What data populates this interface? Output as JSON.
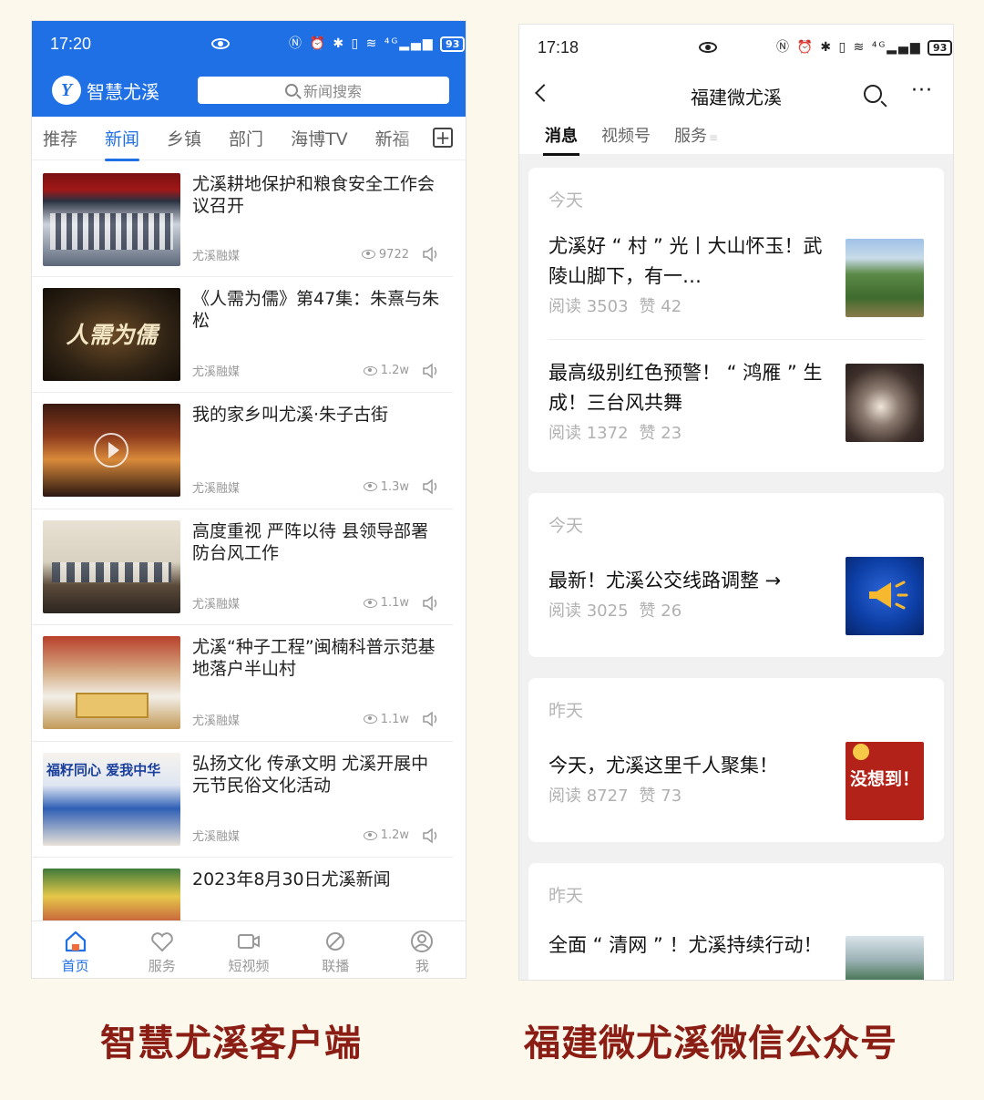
{
  "left_app": {
    "status": {
      "time": "17:20",
      "icons": "Ⓝ ⏰ ✱ ▯ ≋ ⁴ᴳ▂▄▆",
      "battery": "93"
    },
    "app_name": "智慧尤溪",
    "logo_glyph": "Y",
    "search_placeholder": "新闻搜索",
    "tabs": [
      "推荐",
      "新闻",
      "乡镇",
      "部门",
      "海博TV",
      "新福"
    ],
    "tab_add": "+",
    "news": [
      {
        "title": "尤溪耕地保护和粮食安全工作会议召开",
        "source": "尤溪融媒",
        "views": "9722"
      },
      {
        "title": "《人需为儒》第47集：朱熹与朱松",
        "source": "尤溪融媒",
        "views": "1.2w",
        "thumb_text": "人需为儒"
      },
      {
        "title": "我的家乡叫尤溪·朱子古街",
        "source": "尤溪融媒",
        "views": "1.3w"
      },
      {
        "title": "高度重视 严阵以待 县领导部署防台风工作",
        "source": "尤溪融媒",
        "views": "1.1w"
      },
      {
        "title": "尤溪“种子工程”闽楠科普示范基地落户半山村",
        "source": "尤溪融媒",
        "views": "1.1w"
      },
      {
        "title": "弘扬文化 传承文明 尤溪开展中元节民俗文化活动",
        "source": "尤溪融媒",
        "views": "1.2w",
        "thumb_text": "福籽同心 爱我中华"
      },
      {
        "title": "2023年8月30日尤溪新闻",
        "source": "",
        "views": ""
      }
    ],
    "nav": [
      "首页",
      "服务",
      "短视频",
      "联播",
      "我"
    ],
    "accent": "#1f6fe5"
  },
  "right_app": {
    "status": {
      "time": "17:18",
      "icons": "Ⓝ ⏰ ✱ ▯ ≋ ⁴ᴳ▂▄▆",
      "battery": "93"
    },
    "title": "福建微尤溪",
    "more": "···",
    "tabs": [
      "消息",
      "视频号",
      "服务"
    ],
    "tab_suffix": "≡",
    "cards": [
      {
        "day": "今天",
        "articles": [
          {
            "title": "尤溪好 “ 村 ” 光丨大山怀玉！武陵山脚下，有一…",
            "read": "阅读 3503",
            "like": "赞 42"
          },
          {
            "title": "最高级别红色预警！ “ 鸿雁 ” 生成！三台风共舞",
            "read": "阅读 1372",
            "like": "赞 23"
          }
        ]
      },
      {
        "day": "今天",
        "articles": [
          {
            "title": "最新！尤溪公交线路调整 →",
            "read": "阅读 3025",
            "like": "赞 26"
          }
        ]
      },
      {
        "day": "昨天",
        "articles": [
          {
            "title": "今天，尤溪这里千人聚集！",
            "read": "阅读 8727",
            "like": "赞 73",
            "thumb_text": "没想到！"
          }
        ]
      },
      {
        "day": "昨天",
        "articles": [
          {
            "title": "全面 “ 清网 ” ！尤溪持续行动！",
            "read": "",
            "like": ""
          }
        ]
      }
    ]
  },
  "captions": {
    "left": "智慧尤溪客户端",
    "right": "福建微尤溪微信公众号"
  },
  "colors": {
    "caption": "#8a1d14",
    "background": "#fdf8ec"
  }
}
